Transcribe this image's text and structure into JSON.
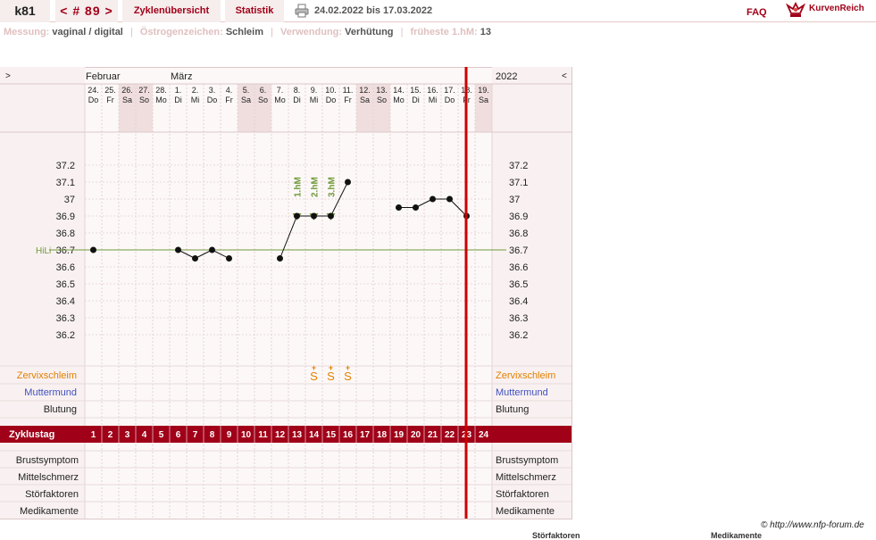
{
  "header": {
    "user": "k81",
    "cycle_label": "< # 89 >",
    "overview_tab": "Zyklenübersicht",
    "stats_tab": "Statistik",
    "date_range": "24.02.2022 bis 17.03.2022",
    "faq": "FAQ",
    "brand": "KurvenReich",
    "print_icon": "printer-icon",
    "logo_icon": "crown-logo-icon"
  },
  "info": {
    "measure_label": "Messung:",
    "measure_value": "vaginal / digital",
    "estrogen_label": "Östrogenzeichen:",
    "estrogen_value": "Schleim",
    "use_label": "Verwendung:",
    "use_value": "Verhütung",
    "earliest_label": "früheste 1.hM:",
    "earliest_value": "13"
  },
  "nav": {
    "left": ">",
    "right": "<"
  },
  "credit": "© http://www.nfp-forum.de",
  "footer_cut": {
    "a": "Störfaktoren",
    "b": "Medikamente"
  },
  "colors": {
    "accent": "#a00018",
    "coverline": "#6f9a3a",
    "mucus": "#e08000",
    "cervix": "#4050c0",
    "marker": "#cc0000"
  },
  "chart_data": {
    "type": "line",
    "months": [
      {
        "label": "Februar",
        "day": 1
      },
      {
        "label": "März",
        "day": 6
      }
    ],
    "year_label": "2022",
    "dates": [
      "24.",
      "25.",
      "26.",
      "27.",
      "28.",
      "1.",
      "2.",
      "3.",
      "4.",
      "5.",
      "6.",
      "7.",
      "8.",
      "9.",
      "10.",
      "11.",
      "12.",
      "13.",
      "14.",
      "15.",
      "16.",
      "17.",
      "18.",
      "19."
    ],
    "weekdays": [
      "Do",
      "Fr",
      "Sa",
      "So",
      "Mo",
      "Di",
      "Mi",
      "Do",
      "Fr",
      "Sa",
      "So",
      "Mo",
      "Di",
      "Mi",
      "Do",
      "Fr",
      "Sa",
      "So",
      "Mo",
      "Di",
      "Mi",
      "Do",
      "Fr",
      "Sa"
    ],
    "weekend_days": [
      3,
      4,
      10,
      11,
      17,
      18,
      24
    ],
    "cycle_days": [
      1,
      2,
      3,
      4,
      5,
      6,
      7,
      8,
      9,
      10,
      11,
      12,
      13,
      14,
      15,
      16,
      17,
      18,
      19,
      20,
      21,
      22,
      23,
      24
    ],
    "y_ticks": [
      "37.2",
      "37.1",
      "37",
      "36.9",
      "36.8",
      "36.7",
      "36.6",
      "36.5",
      "36.4",
      "36.3",
      "36.2"
    ],
    "ylim": [
      36.2,
      37.2
    ],
    "coverline": {
      "label": "HiLi",
      "value": 36.7
    },
    "temperature": [
      {
        "day": 1,
        "value": 36.7
      },
      {
        "day": 6,
        "value": 36.7
      },
      {
        "day": 7,
        "value": 36.65
      },
      {
        "day": 8,
        "value": 36.7
      },
      {
        "day": 9,
        "value": 36.65
      },
      {
        "day": 12,
        "value": 36.65
      },
      {
        "day": 13,
        "value": 36.9
      },
      {
        "day": 14,
        "value": 36.9
      },
      {
        "day": 15,
        "value": 36.9
      },
      {
        "day": 16,
        "value": 37.1
      },
      {
        "day": 19,
        "value": 36.95
      },
      {
        "day": 20,
        "value": 36.95
      },
      {
        "day": 21,
        "value": 37.0
      },
      {
        "day": 22,
        "value": 37.0
      },
      {
        "day": 23,
        "value": 36.9
      }
    ],
    "high_measurements": [
      {
        "day": 13,
        "label": "1.hM"
      },
      {
        "day": 14,
        "label": "2.hM"
      },
      {
        "day": 15,
        "label": "3.hM"
      }
    ],
    "mucus": [
      {
        "day": 14,
        "symbol": "S+"
      },
      {
        "day": 15,
        "symbol": "S+"
      },
      {
        "day": 16,
        "symbol": "S+"
      }
    ],
    "today_marker_day": 23,
    "rows": {
      "zervix": "Zervixschleim",
      "muttermund": "Muttermund",
      "blutung": "Blutung",
      "zyklustag": "Zyklustag",
      "brust": "Brustsymptom",
      "mittel": "Mittelschmerz",
      "stoer": "Störfaktoren",
      "medi": "Medikamente"
    }
  }
}
